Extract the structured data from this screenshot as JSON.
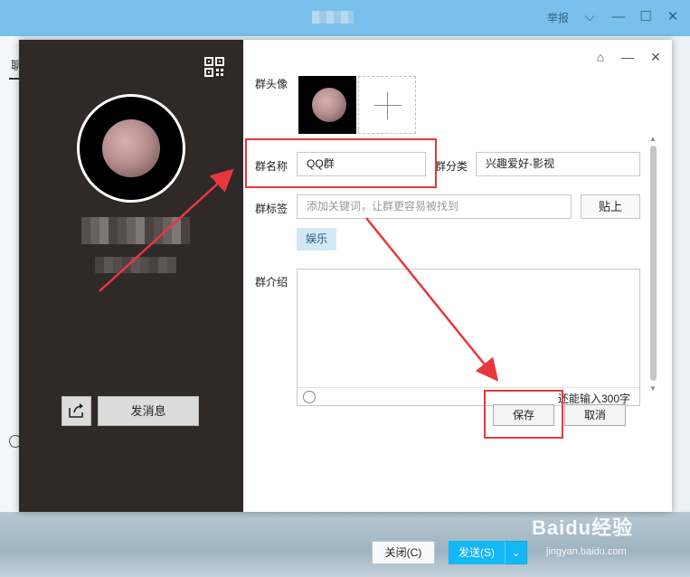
{
  "background_window": {
    "report_label": "举报",
    "tab_label": "聊",
    "close_button": "关闭(C)",
    "send_button": "发送(S)",
    "send_dropdown": "⌄"
  },
  "watermark": {
    "brand": "Baidu经验",
    "url": "jingyan.baidu.com"
  },
  "profile": {
    "send_message_label": "发消息"
  },
  "form": {
    "avatar_label": "群头像",
    "name_label": "群名称",
    "name_value": "QQ群",
    "category_label": "群分类",
    "category_value": "兴趣爱好-影视",
    "tags_label": "群标签",
    "tags_placeholder": "添加关键词，让群更容易被找到",
    "paste_button": "贴上",
    "tag_chip": "娱乐",
    "intro_label": "群介绍",
    "intro_counter": "还能输入300字",
    "save_button": "保存",
    "cancel_button": "取消"
  },
  "icons": {
    "qr": "qr-code-icon",
    "share": "share-icon",
    "pin": "pin-icon",
    "minimize": "minimize-icon",
    "close": "close-icon",
    "smiley": "smiley-icon"
  },
  "colors": {
    "panel_dark": "#2f2927",
    "accent_blue": "#12b7f5",
    "titlebar": "#79c1ec",
    "annotation_red": "#e8373c",
    "tag_bg": "#d3e8f5"
  }
}
